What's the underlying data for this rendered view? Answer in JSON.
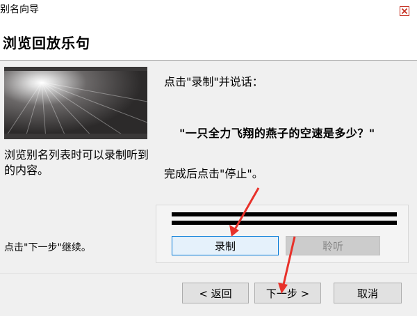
{
  "window": {
    "title": "别名向导"
  },
  "header": {
    "title": "浏览回放乐句"
  },
  "left_panel": {
    "description": "浏览别名列表时可以录制听到的内容。",
    "continue_hint": "点击\"下一步\"继续。"
  },
  "instructions": {
    "line1": "点击\"录制\"并说话：",
    "phrase": "\"一只全力飞翔的燕子的空速是多少？\"",
    "line2": "完成后点击\"停止\"。"
  },
  "audio": {
    "record_label": "录制",
    "listen_label": "聆听"
  },
  "footer": {
    "back_label": "< 返回",
    "next_label": "下一步 >",
    "cancel_label": "取消"
  },
  "colors": {
    "annotation_arrow": "#e8312a",
    "focus_border": "#0078d7",
    "close_icon": "#c42b1c"
  },
  "icons": [
    "close-icon",
    "spotlight-image",
    "annotation-arrow"
  ]
}
